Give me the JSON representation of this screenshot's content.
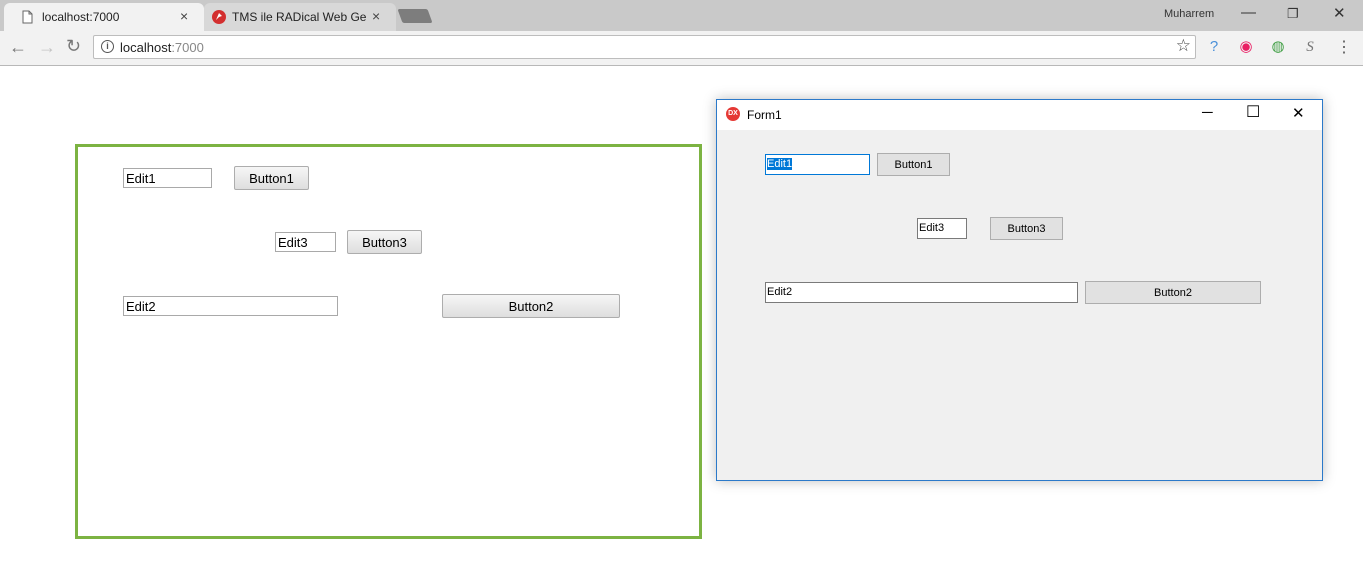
{
  "browser": {
    "tabs": [
      {
        "title": "localhost:7000",
        "close": "×",
        "active": true
      },
      {
        "title": "TMS ile RADical Web Geli",
        "close": "×",
        "active": false
      }
    ],
    "profile_name": "Muharrem",
    "window_controls": {
      "minimize": "—",
      "restore": "❐",
      "close": "✕"
    },
    "nav": {
      "back": "←",
      "forward": "→",
      "reload": "↻"
    },
    "url_host": "localhost",
    "url_port": ":7000",
    "icons": {
      "page": "page-icon",
      "tms": "tms-favicon",
      "info": "info-icon",
      "star": "star-icon",
      "menu": "menu-icon"
    },
    "extensions": [
      {
        "name": "help-extension-icon",
        "glyph": "?",
        "color": "#4a90d9"
      },
      {
        "name": "record-extension-icon",
        "glyph": "◉",
        "color": "#e91e63"
      },
      {
        "name": "globe-extension-icon",
        "glyph": "◍",
        "color": "#43a047"
      },
      {
        "name": "script-extension-icon",
        "glyph": "S",
        "color": "#777777"
      }
    ],
    "menu_glyph": "⋮"
  },
  "web": {
    "border_color": "#7cb342",
    "edit1": "Edit1",
    "edit2": "Edit2",
    "edit3": "Edit3",
    "button1": "Button1",
    "button2": "Button2",
    "button3": "Button3"
  },
  "form": {
    "title": "Form1",
    "icon_text": "DX",
    "controls": {
      "minimize": "─",
      "maximize": "☐",
      "close": "✕"
    },
    "edit1": "Edit1",
    "edit2": "Edit2",
    "edit3": "Edit3",
    "button1": "Button1",
    "button2": "Button2",
    "button3": "Button3",
    "accent": "#0078d7"
  }
}
